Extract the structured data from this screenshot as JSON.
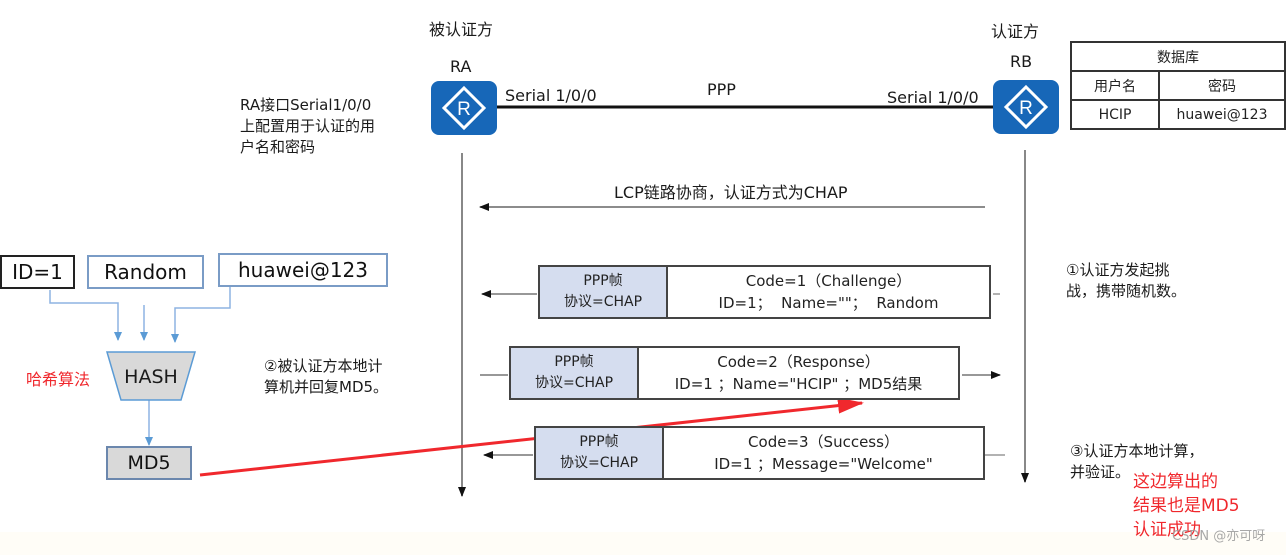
{
  "roles": {
    "authenticatee": "被认证方",
    "authenticator": "认证方"
  },
  "routers": {
    "ra": {
      "name": "RA",
      "interface": "Serial 1/0/0",
      "icon": "router-icon"
    },
    "rb": {
      "name": "RB",
      "interface": "Serial 1/0/0",
      "icon": "router-icon"
    }
  },
  "link_label": "PPP",
  "ra_note": [
    "RA接口Serial1/0/0",
    "上配置用于认证的用",
    "户名和密码"
  ],
  "database": {
    "title": "数据库",
    "headers": [
      "用户名",
      "密码"
    ],
    "rows": [
      [
        "HCIP",
        "huawei@123"
      ]
    ]
  },
  "lcp_message": "LCP链路协商，认证方式为CHAP",
  "frames": [
    {
      "header_line1": "PPP帧",
      "header_line2": "协议=CHAP",
      "line1": "Code=1（Challenge）",
      "line2": "ID=1；  Name=\"\"；  Random",
      "direction": "RB→RA"
    },
    {
      "header_line1": "PPP帧",
      "header_line2": "协议=CHAP",
      "line1": "Code=2（Response）",
      "line2": "ID=1 ；Name=\"HCIP\" ；MD5结果",
      "direction": "RA→RB"
    },
    {
      "header_line1": "PPP帧",
      "header_line2": "协议=CHAP",
      "line1": "Code=3（Success）",
      "line2": "ID=1 ；Message=\"Welcome\"",
      "direction": "RB→RA"
    }
  ],
  "steps": {
    "step1": [
      "①认证方发起挑",
      "战，携带随机数。"
    ],
    "step2": [
      "②被认证方本地计",
      "算机并回复MD5。"
    ],
    "step3": [
      "③认证方本地计算，",
      "并验证。"
    ]
  },
  "hash_inputs": [
    "ID=1",
    "Random",
    "huawei@123"
  ],
  "hash_label": "HASH",
  "hash_output": "MD5",
  "annotations": {
    "hash_algorithm": "哈希算法",
    "result_note": [
      "这边算出的",
      "结果也是MD5",
      "认证成功"
    ]
  },
  "watermark": "CSDN @亦可呀",
  "colors": {
    "router_blue": "#1767b8",
    "frame_header": "#d5ddef",
    "annotation_red": "#f0282d",
    "flow_blue": "#5b9bd5",
    "hash_gray": "#d9d9d9"
  }
}
